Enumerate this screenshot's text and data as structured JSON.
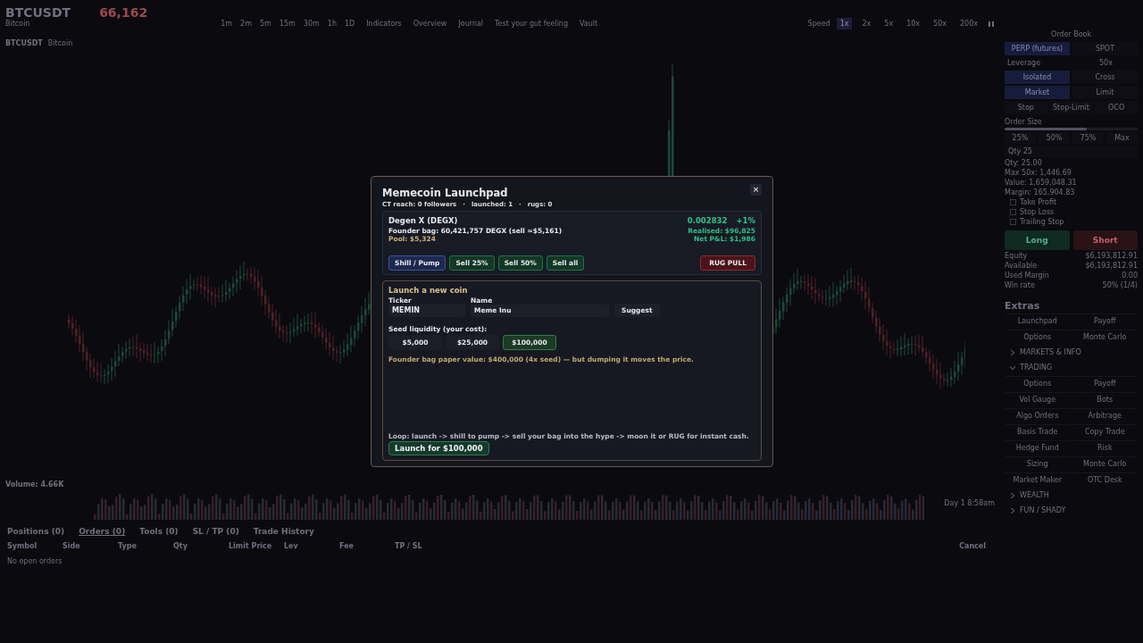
{
  "chart_header": {
    "symbol": "BTCUSDT",
    "name": "Bitcoin",
    "price": "66,162",
    "timeframes": [
      "1m",
      "2m",
      "5m",
      "15m",
      "30m",
      "1h",
      "1D"
    ],
    "tools": [
      "Indicators",
      "Overview",
      "Journal",
      "Test your gut feeling",
      "Vault"
    ],
    "speed_label": "Speed",
    "speeds": [
      {
        "label": "1x",
        "selected": true
      },
      {
        "label": "2x",
        "selected": false
      },
      {
        "label": "5x",
        "selected": false
      },
      {
        "label": "10x",
        "selected": false
      },
      {
        "label": "50x",
        "selected": false
      },
      {
        "label": "200x",
        "selected": false
      }
    ]
  },
  "legend": {
    "symbol": "BTCUSDT",
    "name": "Bitcoin"
  },
  "volume_label": "Volume: 4.66K",
  "clock": "Day 1  8:58am",
  "bottom": {
    "tabs": [
      {
        "label": "Positions (0)",
        "selected": false
      },
      {
        "label": "Orders (0)",
        "selected": true
      },
      {
        "label": "Tools (0)",
        "selected": false
      },
      {
        "label": "SL / TP (0)",
        "selected": false
      },
      {
        "label": "Trade History",
        "selected": false
      }
    ],
    "columns": [
      "Symbol",
      "Side",
      "Type",
      "Qty",
      "Limit Price",
      "Lev",
      "Fee",
      "TP / SL"
    ],
    "action_column": "Cancel",
    "empty": "No open orders"
  },
  "order_panel": {
    "title": "Order Book",
    "markets": [
      {
        "label": "PERP (futures)",
        "selected": true
      },
      {
        "label": "SPOT",
        "selected": false
      }
    ],
    "leverage_label": "Leverage",
    "leverage_value": "50x",
    "margin_modes": [
      {
        "label": "Isolated",
        "selected": true
      },
      {
        "label": "Cross",
        "selected": false
      }
    ],
    "order_types": [
      {
        "label": "Market",
        "selected": true
      },
      {
        "label": "Limit",
        "selected": false
      },
      {
        "label": "Stop",
        "selected": false
      },
      {
        "label": "Stop-Limit",
        "selected": false
      },
      {
        "label": "OCO",
        "selected": false
      }
    ],
    "size_label": "Order Size",
    "size_slider": {
      "level": 0.62
    },
    "presets": [
      "25%",
      "50%",
      "75%",
      "Max"
    ],
    "qty_field": "Qty  25",
    "summary": [
      "Qty: 25.00",
      "Max 50x: 1,446.69",
      "Value: 1,659,048.31",
      "Margin: 165,904.83"
    ],
    "options": [
      {
        "label": "Take Profit",
        "checked": false
      },
      {
        "label": "Stop Loss",
        "checked": false
      },
      {
        "label": "Trailing Stop",
        "checked": false
      }
    ],
    "long": "Long",
    "short": "Short",
    "stats": [
      {
        "label": "Equity",
        "value": "$6,193,812.91"
      },
      {
        "label": "Available",
        "value": "$6,193,812.91"
      },
      {
        "label": "Used Margin",
        "value": "0.00"
      },
      {
        "label": "Win rate",
        "value": "50% (1/4)"
      }
    ]
  },
  "extras": {
    "title": "Extras",
    "quick": [
      "Launchpad",
      "Payoff",
      "Options",
      "Monte Carlo"
    ],
    "sections": [
      {
        "title": "MARKETS & INFO",
        "expanded": false
      },
      {
        "title": "TRADING",
        "expanded": true,
        "items": [
          "Options",
          "Payoff",
          "Vol Gauge",
          "Bots",
          "Algo Orders",
          "Arbitrage",
          "Basis Trade",
          "Copy Trade",
          "Hedge Fund",
          "Risk",
          "Sizing",
          "Monte Carlo",
          "Market Maker",
          "OTC Desk"
        ]
      },
      {
        "title": "WEALTH",
        "expanded": false
      },
      {
        "title": "FUN / SHADY",
        "expanded": false
      }
    ]
  },
  "modal": {
    "title": "Memecoin Launchpad",
    "close": "×",
    "stats": [
      "CT reach: 0 followers",
      "launched: 1",
      "rugs: 0"
    ],
    "separator": "·",
    "coin": {
      "name": "Degen X  (DEGX)",
      "price": "0.002832",
      "change": "+1%",
      "bag": "Founder bag:  60,421,757 DEGX   (sell ≈$5,161)",
      "pool": "Pool:  $5,324",
      "realised": "Realised:  $96,825",
      "net": "Net P&L:  $1,986",
      "actions": [
        {
          "label": "Shill / Pump",
          "kind": "pump"
        },
        {
          "label": "Sell 25%",
          "kind": "sell"
        },
        {
          "label": "Sell 50%",
          "kind": "sell"
        },
        {
          "label": "Sell all",
          "kind": "sell"
        },
        {
          "label": "RUG PULL",
          "kind": "rug"
        }
      ]
    },
    "launch": {
      "heading": "Launch a new coin",
      "ticker_label": "Ticker",
      "ticker": "MEMIN",
      "name_label": "Name",
      "name": "Meme Inu",
      "suggest": "Suggest",
      "seed_label": "Seed liquidity (your cost):",
      "seeds": [
        {
          "label": "$5,000",
          "selected": false
        },
        {
          "label": "$25,000",
          "selected": false
        },
        {
          "label": "$100,000",
          "selected": true
        }
      ],
      "note": "Founder bag paper value:  $400,000  (4x seed) — but dumping it moves the price.",
      "loop": "Loop: launch -> shill to pump -> sell your bag into the hype -> moon it or RUG for instant cash.",
      "button": "Launch for $100,000"
    }
  }
}
